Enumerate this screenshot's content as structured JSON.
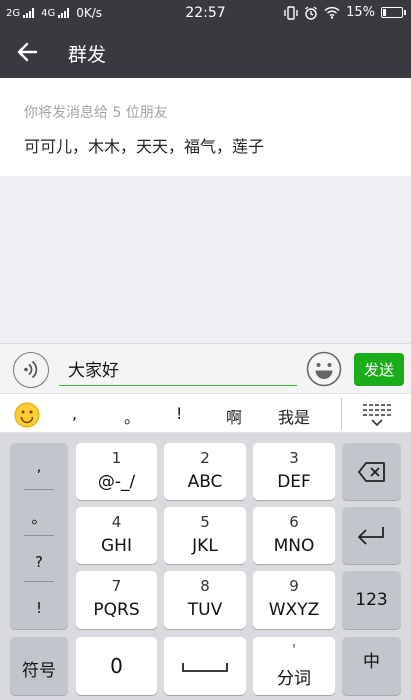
{
  "status_bar": {
    "network_left": "2G",
    "network_right": "4G",
    "speed": "0K/s",
    "time": "22:57",
    "battery": "15%",
    "battery_level": 0.15
  },
  "header": {
    "title": "群发"
  },
  "recipients": {
    "hint": "你将发消息给 5 位朋友",
    "names": "可可儿，木木，天天，福气，莲子"
  },
  "composer": {
    "message": "大家好",
    "send_label": "发送"
  },
  "candidates": [
    ",",
    "。",
    "!",
    "啊",
    "我是"
  ],
  "keyboard": {
    "punctuation": [
      ",",
      "。",
      "?",
      "!"
    ],
    "keys": [
      {
        "num": "1",
        "label": "@-_/"
      },
      {
        "num": "2",
        "label": "ABC"
      },
      {
        "num": "3",
        "label": "DEF"
      },
      {
        "num": "4",
        "label": "GHI"
      },
      {
        "num": "5",
        "label": "JKL"
      },
      {
        "num": "6",
        "label": "MNO"
      },
      {
        "num": "7",
        "label": "PQRS"
      },
      {
        "num": "8",
        "label": "TUV"
      },
      {
        "num": "9",
        "label": "WXYZ"
      }
    ],
    "symbols_label": "符号",
    "zero_label": "0",
    "segment_label": "分词",
    "numeric_label": "123",
    "lang_label": "中"
  },
  "colors": {
    "bar_dark": "#393a3f",
    "send_green": "#1aad19",
    "underline_green": "#3db337"
  }
}
